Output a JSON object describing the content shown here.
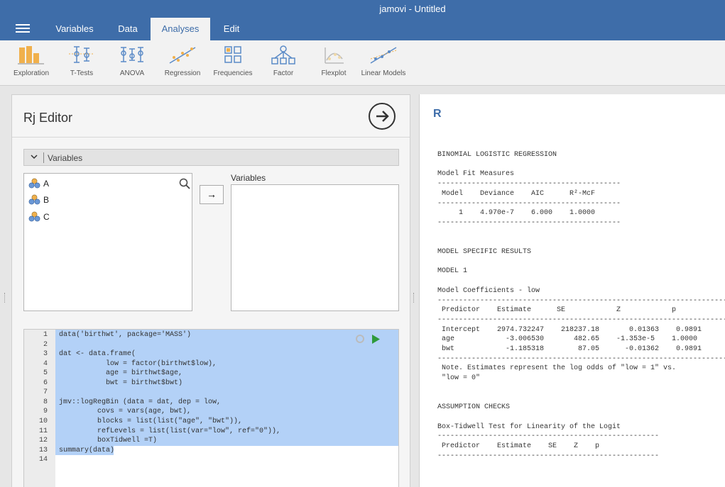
{
  "window": {
    "title": "jamovi - Untitled"
  },
  "tabs": [
    "Variables",
    "Data",
    "Analyses",
    "Edit"
  ],
  "ribbon": [
    "Exploration",
    "T-Tests",
    "ANOVA",
    "Regression",
    "Frequencies",
    "Factor",
    "Flexplot",
    "Linear Models"
  ],
  "editor": {
    "title": "Rj Editor",
    "variables_section": "Variables",
    "source_variables": [
      "A",
      "B",
      "C"
    ],
    "target_label": "Variables",
    "move_button": "→"
  },
  "code": [
    {
      "n": "1",
      "t": "data('birthwt', package='MASS')"
    },
    {
      "n": "2",
      "t": ""
    },
    {
      "n": "3",
      "t": "dat <- data.frame("
    },
    {
      "n": "4",
      "t": "           low = factor(birthwt$low),"
    },
    {
      "n": "5",
      "t": "           age = birthwt$age,"
    },
    {
      "n": "6",
      "t": "           bwt = birthwt$bwt)"
    },
    {
      "n": "7",
      "t": ""
    },
    {
      "n": "8",
      "t": "jmv::logRegBin (data = dat, dep = low,"
    },
    {
      "n": "9",
      "t": "         covs = vars(age, bwt),"
    },
    {
      "n": "10",
      "t": "         blocks = list(list(\"age\", \"bwt\")),"
    },
    {
      "n": "11",
      "t": "         refLevels = list(list(var=\"low\", ref=\"0\")),"
    },
    {
      "n": "12",
      "t": "         boxTidwell =T)"
    },
    {
      "n": "13",
      "t": "summary(data)"
    },
    {
      "n": "14",
      "t": ""
    }
  ],
  "results": {
    "heading": "R",
    "lines": [
      {
        "row": 0,
        "t": "BINOMIAL LOGISTIC REGRESSION"
      },
      {
        "row": 2,
        "t": "Model Fit Measures"
      },
      {
        "row": 3,
        "t": "-------------------------------------------"
      },
      {
        "row": 4,
        "t": " Model    Deviance    AIC      R²-McF"
      },
      {
        "row": 5,
        "t": "-------------------------------------------"
      },
      {
        "row": 6,
        "t": "     1    4.970e-7    6.000    1.0000"
      },
      {
        "row": 7,
        "t": "-------------------------------------------"
      },
      {
        "row": 10,
        "t": "MODEL SPECIFIC RESULTS"
      },
      {
        "row": 12,
        "t": "MODEL 1"
      },
      {
        "row": 14,
        "t": "Model Coefficients - low"
      },
      {
        "row": 15,
        "t": "-----------------------------------------------------------------------"
      },
      {
        "row": 16,
        "t": " Predictor    Estimate      SE            Z            p"
      },
      {
        "row": 17,
        "t": "-----------------------------------------------------------------------"
      },
      {
        "row": 18,
        "t": " Intercept    2974.732247    218237.18       0.01363    0.9891"
      },
      {
        "row": 19,
        "t": " age            -3.006530       482.65    -1.353e-5    1.0000"
      },
      {
        "row": 20,
        "t": " bwt            -1.185318        87.05      -0.01362    0.9891"
      },
      {
        "row": 21,
        "t": "-----------------------------------------------------------------------"
      },
      {
        "row": 22,
        "t": " Note. Estimates represent the log odds of \"low = 1\" vs."
      },
      {
        "row": 23,
        "t": " \"low = 0\""
      },
      {
        "row": 26,
        "t": "ASSUMPTION CHECKS"
      },
      {
        "row": 28,
        "t": "Box-Tidwell Test for Linearity of the Logit"
      },
      {
        "row": 29,
        "t": "----------------------------------------------------"
      },
      {
        "row": 30,
        "t": " Predictor    Estimate    SE    Z    p"
      },
      {
        "row": 31,
        "t": "----------------------------------------------------"
      }
    ]
  },
  "colors": {
    "brand": "#3e6da9",
    "selection": "#b3d1f7",
    "run": "#2e9a3c"
  }
}
